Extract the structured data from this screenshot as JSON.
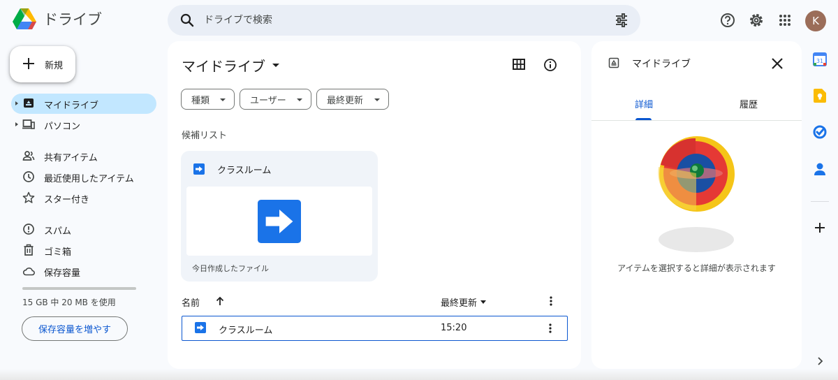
{
  "app": {
    "title": "ドライブ"
  },
  "search": {
    "placeholder": "ドライブで検索"
  },
  "user": {
    "initial": "K",
    "avatar_color": "#9b6d59"
  },
  "nav": {
    "new_label": "新規",
    "items": [
      {
        "label": "マイドライブ",
        "icon": "my-drive-icon",
        "active": true,
        "expandable": true
      },
      {
        "label": "パソコン",
        "icon": "computers-icon",
        "active": false,
        "expandable": true
      },
      {
        "label": "共有アイテム",
        "icon": "people-icon",
        "active": false
      },
      {
        "label": "最近使用したアイテム",
        "icon": "clock-icon",
        "active": false
      },
      {
        "label": "スター付き",
        "icon": "star-icon",
        "active": false
      },
      {
        "label": "スパム",
        "icon": "spam-icon",
        "active": false
      },
      {
        "label": "ゴミ箱",
        "icon": "trash-icon",
        "active": false
      },
      {
        "label": "保存容量",
        "icon": "cloud-icon",
        "active": false
      }
    ],
    "storage_text": "15 GB 中 20 MB を使用",
    "storage_used_fraction": 0.0013,
    "storage_button": "保存容量を増やす"
  },
  "main": {
    "title": "マイドライブ",
    "filters": [
      "種類",
      "ユーザー",
      "最終更新"
    ],
    "suggested_label": "候補リスト",
    "suggested": {
      "name": "クラスルーム",
      "subtitle": "今日作成したファイル"
    },
    "columns": {
      "name": "名前",
      "modified": "最終更新"
    },
    "rows": [
      {
        "name": "クラスルーム",
        "modified": "15:20"
      }
    ]
  },
  "details": {
    "title": "マイドライブ",
    "tabs": [
      "詳細",
      "履歴"
    ],
    "active_tab": 0,
    "empty_message": "アイテムを選択すると詳細が表示されます"
  },
  "rail": {
    "icons": [
      "calendar-icon",
      "keep-icon",
      "tasks-icon",
      "contacts-icon",
      "add-icon",
      "expand-icon"
    ]
  },
  "colors": {
    "accent": "#0b57d0",
    "active_nav": "#c2e7ff",
    "shortcut_blue": "#1a73e8"
  }
}
